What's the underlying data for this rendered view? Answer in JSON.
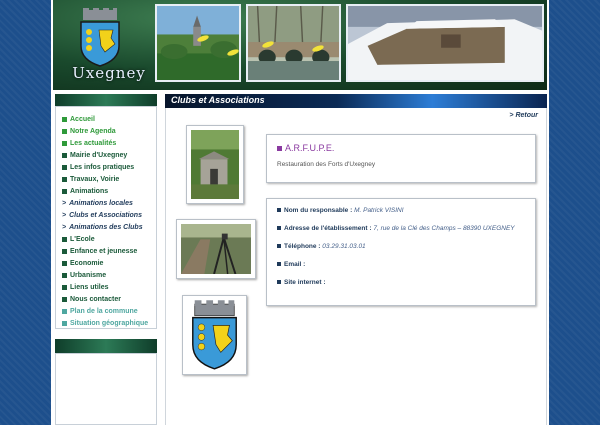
{
  "header": {
    "site_name": "Uxegney"
  },
  "menu": {
    "items": [
      {
        "label": "Accueil",
        "style": "green",
        "color": "#2f9a3a"
      },
      {
        "label": "Notre Agenda",
        "style": "green",
        "color": "#2f9a3a"
      },
      {
        "label": "Les actualités",
        "style": "green",
        "color": "#2f9a3a"
      },
      {
        "label": "Mairie d'Uxegney",
        "style": "normal",
        "color": "#1b5a3a"
      },
      {
        "label": "Les infos pratiques",
        "style": "normal",
        "color": "#1b5a3a"
      },
      {
        "label": "Travaux, Voirie",
        "style": "normal",
        "color": "#1b5a3a"
      },
      {
        "label": "Animations",
        "style": "normal",
        "color": "#1b5a3a"
      },
      {
        "label": "Animations locales",
        "style": "sub",
        "color": "#1f3a5a"
      },
      {
        "label": "Clubs et Associations",
        "style": "sub",
        "color": "#1f3a5a"
      },
      {
        "label": "Animations des Clubs",
        "style": "sub",
        "color": "#1f3a5a"
      },
      {
        "label": "L'Ecole",
        "style": "normal",
        "color": "#1b5a3a"
      },
      {
        "label": "Enfance et jeunesse",
        "style": "normal",
        "color": "#1b5a3a"
      },
      {
        "label": "Economie",
        "style": "normal",
        "color": "#1b5a3a"
      },
      {
        "label": "Urbanisme",
        "style": "normal",
        "color": "#1b5a3a"
      },
      {
        "label": "Liens utiles",
        "style": "normal",
        "color": "#1b5a3a"
      },
      {
        "label": "Nous contacter",
        "style": "normal",
        "color": "#1b5a3a"
      },
      {
        "label": "Plan de la commune",
        "style": "light",
        "color": "#4fa7a0"
      },
      {
        "label": "Situation géographique",
        "style": "light",
        "color": "#4fa7a0"
      }
    ],
    "sub_arrow": ">"
  },
  "main": {
    "title": "Clubs et Associations",
    "retour": "> Retour",
    "association": {
      "name": "A.R.F.U.P.E.",
      "description": "Restauration des Forts d'Uxegney"
    },
    "details": [
      {
        "label": "Nom du responsable :",
        "value": "M. Patrick VISINI"
      },
      {
        "label": "Adresse de l'établissement :",
        "value": "7, rue de la Clé des Champs – 88390 UXEGNEY"
      },
      {
        "label": "Téléphone :",
        "value": "03.29.31.03.01"
      },
      {
        "label": "Email :",
        "value": ""
      },
      {
        "label": "Site internet :",
        "value": ""
      }
    ]
  },
  "colors": {
    "background": "#1d4f8c",
    "accent_purple": "#8a3aa0",
    "menu_green": "#1b5a3a",
    "crest_blue": "#3a9ad8",
    "crest_gold": "#f2d21a"
  },
  "icons": [
    "coat-of-arms-icon",
    "menu-square-icon",
    "field-square-icon"
  ]
}
